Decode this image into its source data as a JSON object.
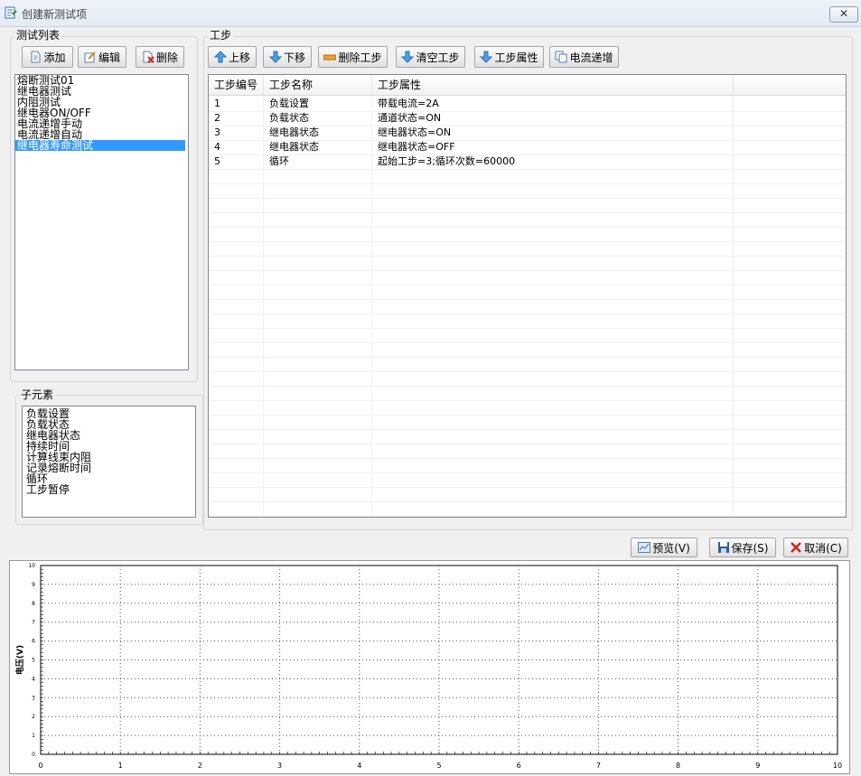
{
  "window": {
    "title": "创建新测试项",
    "close_label": "✕"
  },
  "test_list": {
    "group_label": "测试列表",
    "buttons": {
      "add": "添加",
      "edit": "编辑",
      "delete": "删除"
    },
    "items": [
      "熔断测试01",
      "继电器测试",
      "内阻测试",
      "继电器ON/OFF",
      "电流递增手动",
      "电流递增自动",
      "继电器寿命测试"
    ],
    "selected_index": 6
  },
  "sub_elements": {
    "group_label": "子元素",
    "items": [
      "负载设置",
      "负载状态",
      "继电器状态",
      "持续时间",
      "计算线束内阻",
      "记录熔断时间",
      "循环",
      "工步暂停"
    ]
  },
  "steps": {
    "group_label": "工步",
    "buttons": {
      "up": "上移",
      "down": "下移",
      "delete_step": "删除工步",
      "clear_steps": "清空工步",
      "step_props": "工步属性",
      "current_inc": "电流递增"
    },
    "columns": [
      "工步编号",
      "工步名称",
      "工步属性",
      ""
    ],
    "rows": [
      {
        "id": "1",
        "name": "负载设置",
        "prop": "带载电流=2A"
      },
      {
        "id": "2",
        "name": "负载状态",
        "prop": "通道状态=ON"
      },
      {
        "id": "3",
        "name": "继电器状态",
        "prop": "继电器状态=ON"
      },
      {
        "id": "4",
        "name": "继电器状态",
        "prop": "继电器状态=OFF"
      },
      {
        "id": "5",
        "name": "循环",
        "prop": "起始工步=3;循环次数=60000"
      }
    ]
  },
  "actions": {
    "preview": "预览(V)",
    "save": "保存(S)",
    "cancel": "取消(C)"
  },
  "chart_data": {
    "type": "line",
    "title": "",
    "xlabel": "",
    "ylabel": "电压(V)",
    "xlim": [
      0,
      10
    ],
    "ylim": [
      0,
      10
    ],
    "x_ticks": [
      "0",
      "1",
      "2",
      "3",
      "4",
      "5",
      "6",
      "7",
      "8",
      "9",
      "10"
    ],
    "y_ticks": [
      "0",
      "1",
      "2",
      "3",
      "4",
      "5",
      "6",
      "7",
      "8",
      "9",
      "10"
    ],
    "grid": true,
    "series": []
  }
}
